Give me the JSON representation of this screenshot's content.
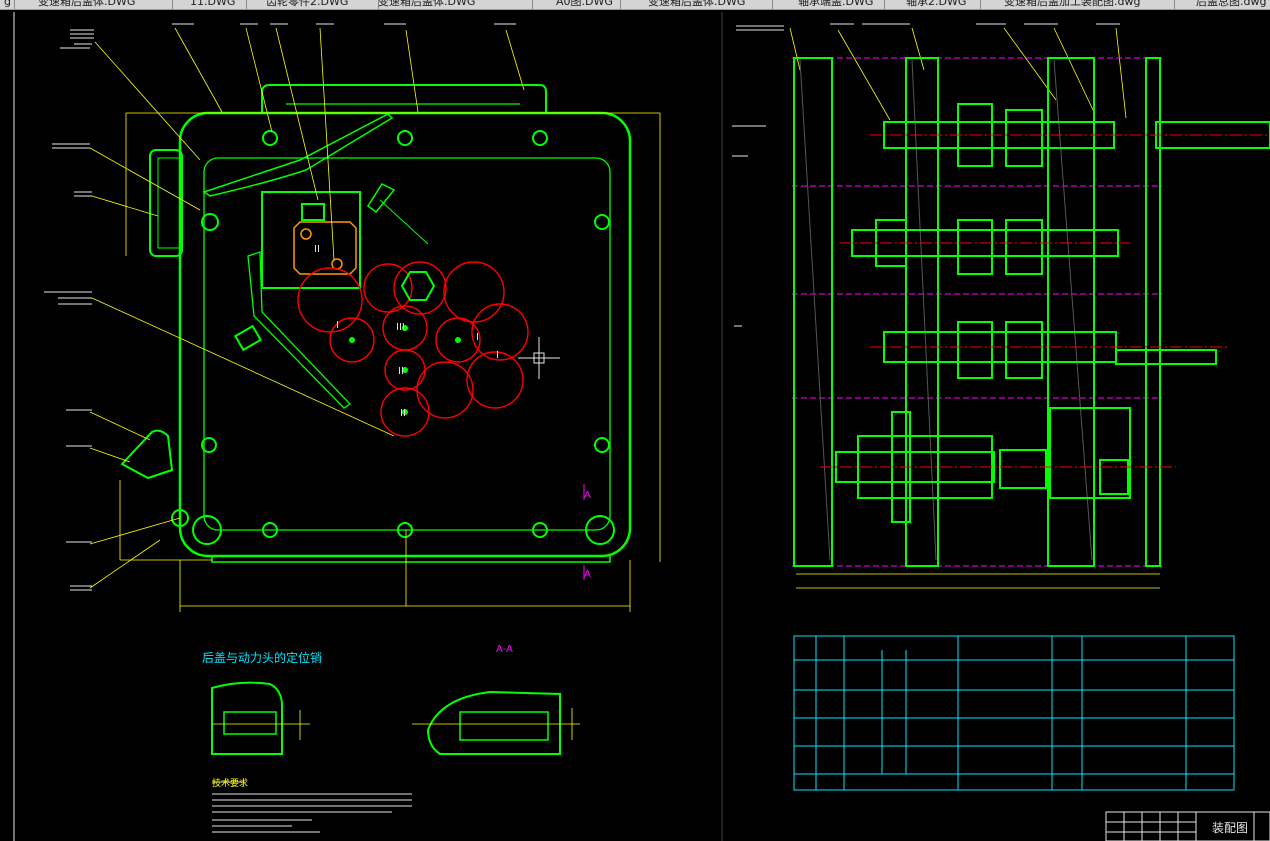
{
  "tabs": [
    {
      "label": "g",
      "active": false
    },
    {
      "label": "变速箱后盖体.DWG",
      "active": false
    },
    {
      "label": "11.DWG",
      "active": false
    },
    {
      "label": "齿轮零件2.DWG",
      "active": false
    },
    {
      "label": "变速箱后盖体.DWG",
      "active": false
    },
    {
      "label": "A0图.DWG",
      "active": false
    },
    {
      "label": "变速箱后盖体.DWG",
      "active": false
    },
    {
      "label": "轴承端盖.DWG",
      "active": false
    },
    {
      "label": "轴承2.DWG",
      "active": false
    },
    {
      "label": "变速箱后盖加工装配图.dwg",
      "active": true
    },
    {
      "label": "后盖总图.dwg",
      "active": false
    }
  ],
  "drawing": {
    "detail_title": "后盖与动力头的定位销",
    "section_label": "A-A",
    "section_mark": "A",
    "notes_heading": "技术要求",
    "title_block_name": "装配图",
    "roman_numerals": [
      "I",
      "II",
      "III",
      "I",
      "II",
      "I",
      "II"
    ]
  },
  "colors": {
    "background": "#000000",
    "outline": "#00ff00",
    "leader": "#ffff00",
    "gear": "#ff0000",
    "centerline": "#ff0000",
    "table": "#00e5ff",
    "phantom": "#ff00ff",
    "text": "#e6e6e6",
    "orange": "#ff9900"
  }
}
